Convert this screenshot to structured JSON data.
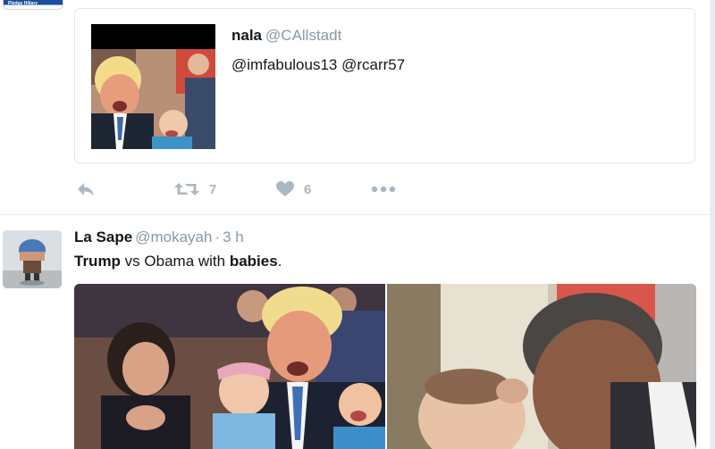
{
  "top_avatar": {
    "label": "Pledge Hillary"
  },
  "quoted_tweet": {
    "name": "nala",
    "handle": "@CAllstadt",
    "text": "@imfabulous13 @rcarr57"
  },
  "actions": {
    "reply_icon": "reply-icon",
    "retweet_icon": "retweet-icon",
    "retweet_count": "7",
    "like_icon": "heart-icon",
    "like_count": "6",
    "more_icon": "more-dots-icon"
  },
  "tweet": {
    "name": "La Sape",
    "handle": "@mokayah",
    "separator": "·",
    "time": "3 h",
    "text_bold_1": "Trump",
    "text_mid": " vs Obama with ",
    "text_bold_2": "babies",
    "text_end": "."
  },
  "colors": {
    "icon_gray": "#aab8c2",
    "handle_gray": "#8899a6",
    "text": "#14171a",
    "border": "#e1e8ed"
  }
}
